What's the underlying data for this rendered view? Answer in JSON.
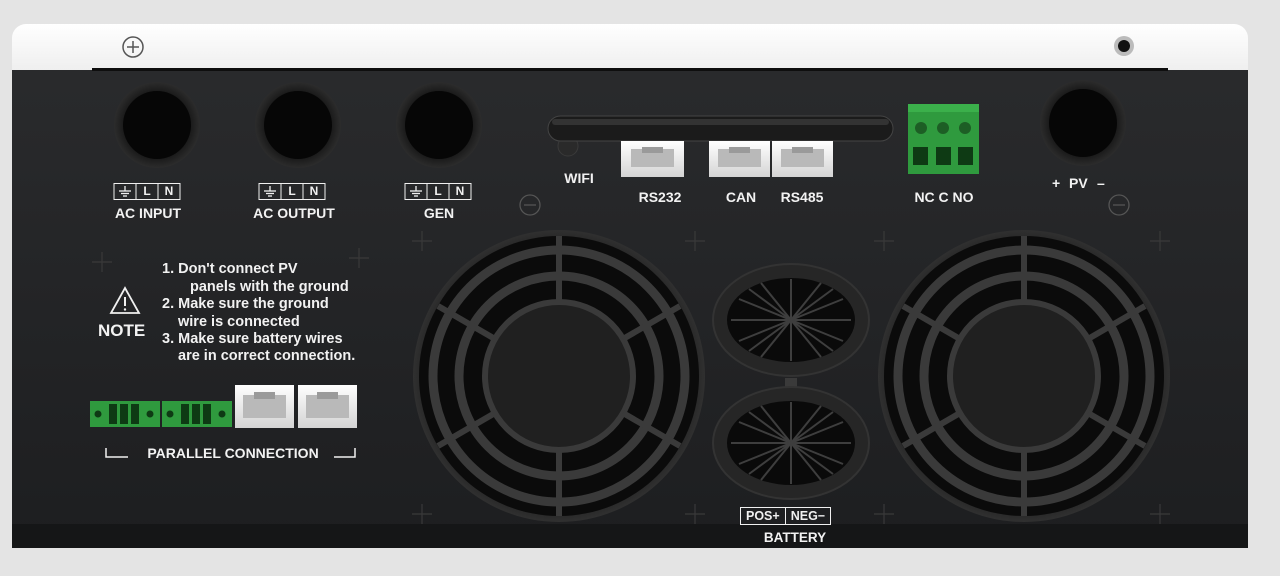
{
  "ports": {
    "ac_input": {
      "label": "AC INPUT",
      "terms": [
        "L",
        "N"
      ]
    },
    "ac_output": {
      "label": "AC OUTPUT",
      "terms": [
        "L",
        "N"
      ]
    },
    "gen": {
      "label": "GEN",
      "terms": [
        "L",
        "N"
      ]
    },
    "wifi": "WIFI",
    "rs232": "RS232",
    "can": "CAN",
    "rs485": "RS485",
    "relay": "NC C NO",
    "pv_plus": "+",
    "pv": "PV",
    "pv_minus": "–"
  },
  "note": {
    "title": "NOTE",
    "lines": [
      "1. Don't connect PV",
      "panels with the ground",
      "2. Make sure the ground",
      "wire is connected",
      "3. Make sure battery wires",
      "are in correct connection."
    ]
  },
  "parallel": {
    "label": "PARALLEL CONNECTION"
  },
  "battery": {
    "label": "BATTERY",
    "pos": "POS+",
    "neg": "NEG−"
  },
  "icons": [
    "screw-icon",
    "warning-icon",
    "ground-icon",
    "fan-grille-icon",
    "battery-terminal-icon",
    "wifi-antenna-icon"
  ],
  "colors": {
    "body": "#1f2022",
    "top_cover": "#f7f7f7",
    "terminal_green": "#2f9a3e",
    "label": "#f2f2f2"
  }
}
